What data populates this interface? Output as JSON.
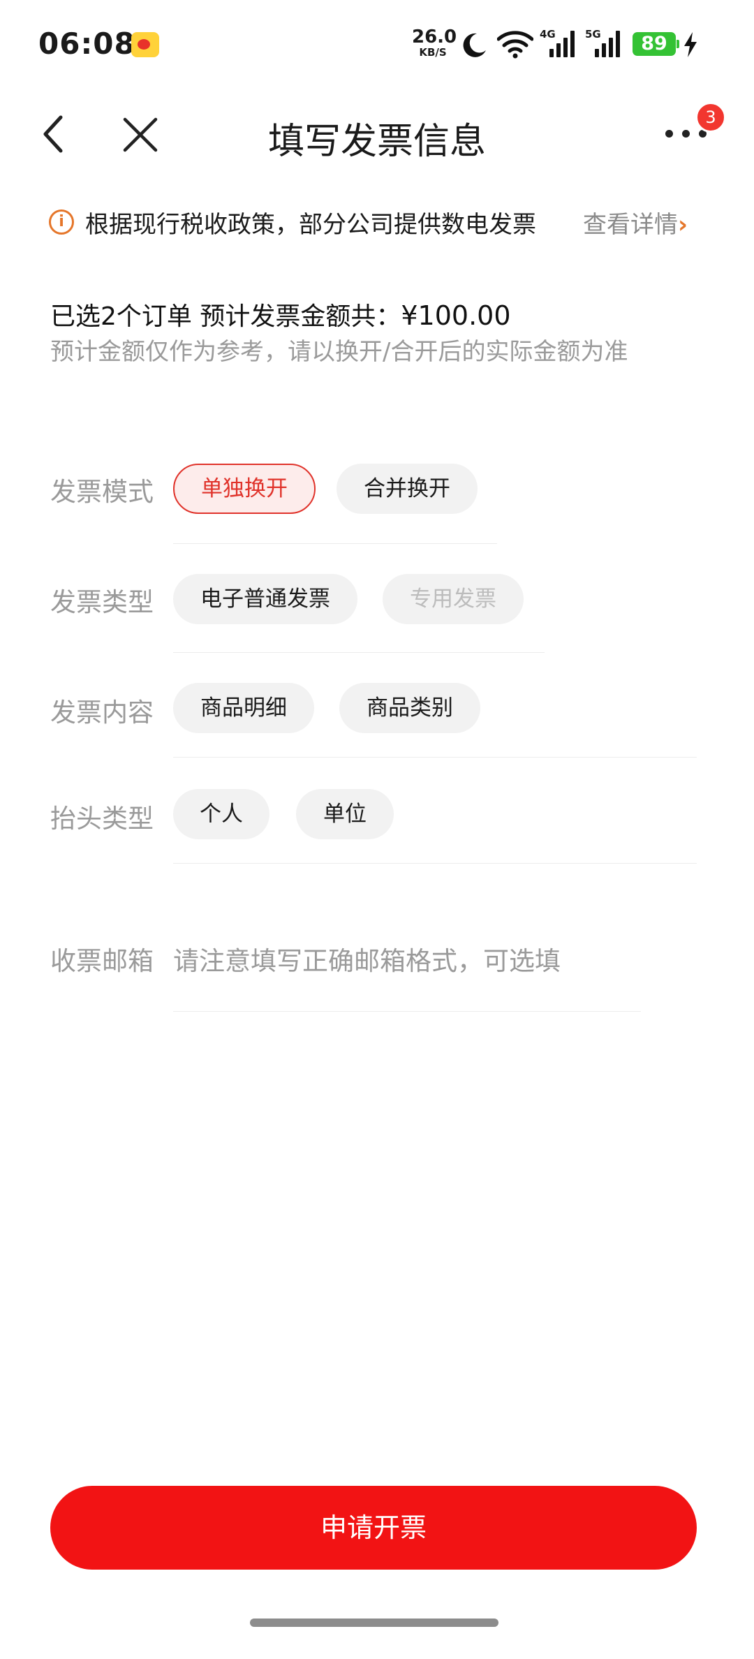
{
  "status_bar": {
    "time": "06:08",
    "net_speed": "26.0",
    "net_unit": "KB/S",
    "signal_1_tag": "4G",
    "signal_2_tag": "5G",
    "battery": "89"
  },
  "header": {
    "title": "填写发票信息",
    "more_badge": "3"
  },
  "notice": {
    "icon": "i",
    "text": "根据现行税收政策，部分公司提供数电发票",
    "link": "查看详情",
    "link_chevron": "›"
  },
  "summary": {
    "prefix": "已选2个订单 预计发票金额共：",
    "amount": "¥100.00",
    "note": "预计金额仅作为参考，请以换开/合开后的实际金额为准"
  },
  "form": {
    "mode": {
      "label": "发票模式",
      "options": [
        "单独换开",
        "合并换开"
      ]
    },
    "type": {
      "label": "发票类型",
      "options": [
        "电子普通发票",
        "专用发票"
      ]
    },
    "content": {
      "label": "发票内容",
      "options": [
        "商品明细",
        "商品类别"
      ]
    },
    "title_type": {
      "label": "抬头类型",
      "options": [
        "个人",
        "单位"
      ]
    },
    "email": {
      "label": "收票邮箱",
      "placeholder": "请注意填写正确邮箱格式，可选填"
    }
  },
  "submit_label": "申请开票",
  "colors": {
    "accent": "#f21314",
    "selected_text": "#e0322a",
    "notice_icon": "#e5762a"
  }
}
